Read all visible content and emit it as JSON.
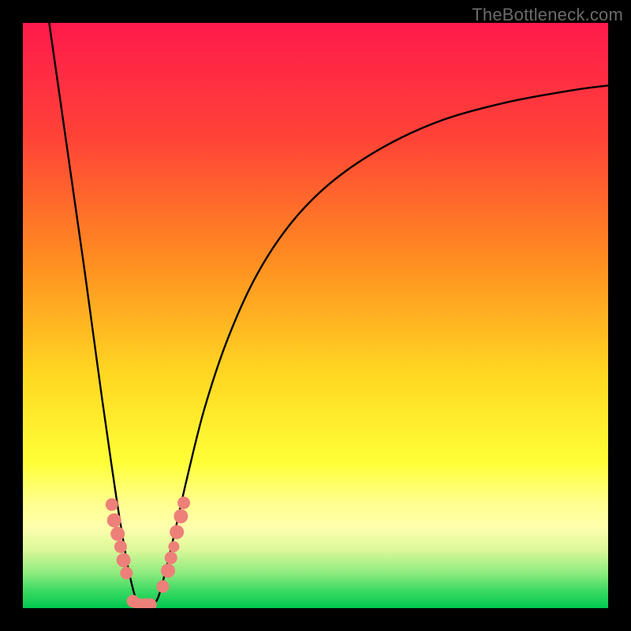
{
  "watermark": "TheBottleneck.com",
  "chart_data": {
    "type": "line",
    "title": "",
    "xlabel": "",
    "ylabel": "",
    "xlim": [
      0,
      1
    ],
    "ylim": [
      0,
      1
    ],
    "gradient_stops": [
      {
        "pos": 0.0,
        "color": "#ff1a4c"
      },
      {
        "pos": 0.2,
        "color": "#ff4437"
      },
      {
        "pos": 0.4,
        "color": "#ff8b21"
      },
      {
        "pos": 0.6,
        "color": "#ffd722"
      },
      {
        "pos": 0.75,
        "color": "#ffff36"
      },
      {
        "pos": 0.82,
        "color": "#ffff8e"
      },
      {
        "pos": 0.86,
        "color": "#ffffad"
      },
      {
        "pos": 0.9,
        "color": "#dcf89a"
      },
      {
        "pos": 0.94,
        "color": "#8eeb7e"
      },
      {
        "pos": 0.97,
        "color": "#3cda63"
      },
      {
        "pos": 1.0,
        "color": "#00c84f"
      }
    ],
    "series": [
      {
        "name": "curve",
        "x": [
          0.045,
          0.06,
          0.075,
          0.09,
          0.105,
          0.12,
          0.135,
          0.15,
          0.165,
          0.18,
          0.195,
          0.205,
          0.215,
          0.225,
          0.235,
          0.255,
          0.28,
          0.31,
          0.35,
          0.4,
          0.46,
          0.53,
          0.62,
          0.72,
          0.83,
          0.94,
          1.0
        ],
        "values": [
          1.0,
          0.895,
          0.79,
          0.685,
          0.58,
          0.47,
          0.36,
          0.255,
          0.155,
          0.068,
          0.01,
          0.002,
          0.002,
          0.008,
          0.03,
          0.11,
          0.22,
          0.34,
          0.46,
          0.57,
          0.66,
          0.73,
          0.79,
          0.835,
          0.865,
          0.885,
          0.893
        ]
      }
    ],
    "markers": [
      {
        "x": 0.152,
        "y_norm": 0.177,
        "r": 8
      },
      {
        "x": 0.156,
        "y_norm": 0.15,
        "r": 9
      },
      {
        "x": 0.162,
        "y_norm": 0.127,
        "r": 9
      },
      {
        "x": 0.167,
        "y_norm": 0.105,
        "r": 8
      },
      {
        "x": 0.172,
        "y_norm": 0.082,
        "r": 9
      },
      {
        "x": 0.177,
        "y_norm": 0.06,
        "r": 8
      },
      {
        "x": 0.188,
        "y_norm": 0.012,
        "r": 8
      },
      {
        "x": 0.198,
        "y_norm": 0.006,
        "r": 8
      },
      {
        "x": 0.208,
        "y_norm": 0.006,
        "r": 8
      },
      {
        "x": 0.218,
        "y_norm": 0.006,
        "r": 8
      },
      {
        "x": 0.239,
        "y_norm": 0.037,
        "r": 8
      },
      {
        "x": 0.248,
        "y_norm": 0.064,
        "r": 9
      },
      {
        "x": 0.253,
        "y_norm": 0.086,
        "r": 8
      },
      {
        "x": 0.258,
        "y_norm": 0.105,
        "r": 7
      },
      {
        "x": 0.263,
        "y_norm": 0.13,
        "r": 9
      },
      {
        "x": 0.27,
        "y_norm": 0.157,
        "r": 9
      },
      {
        "x": 0.275,
        "y_norm": 0.18,
        "r": 8
      }
    ],
    "marker_color": "#ed8079"
  }
}
